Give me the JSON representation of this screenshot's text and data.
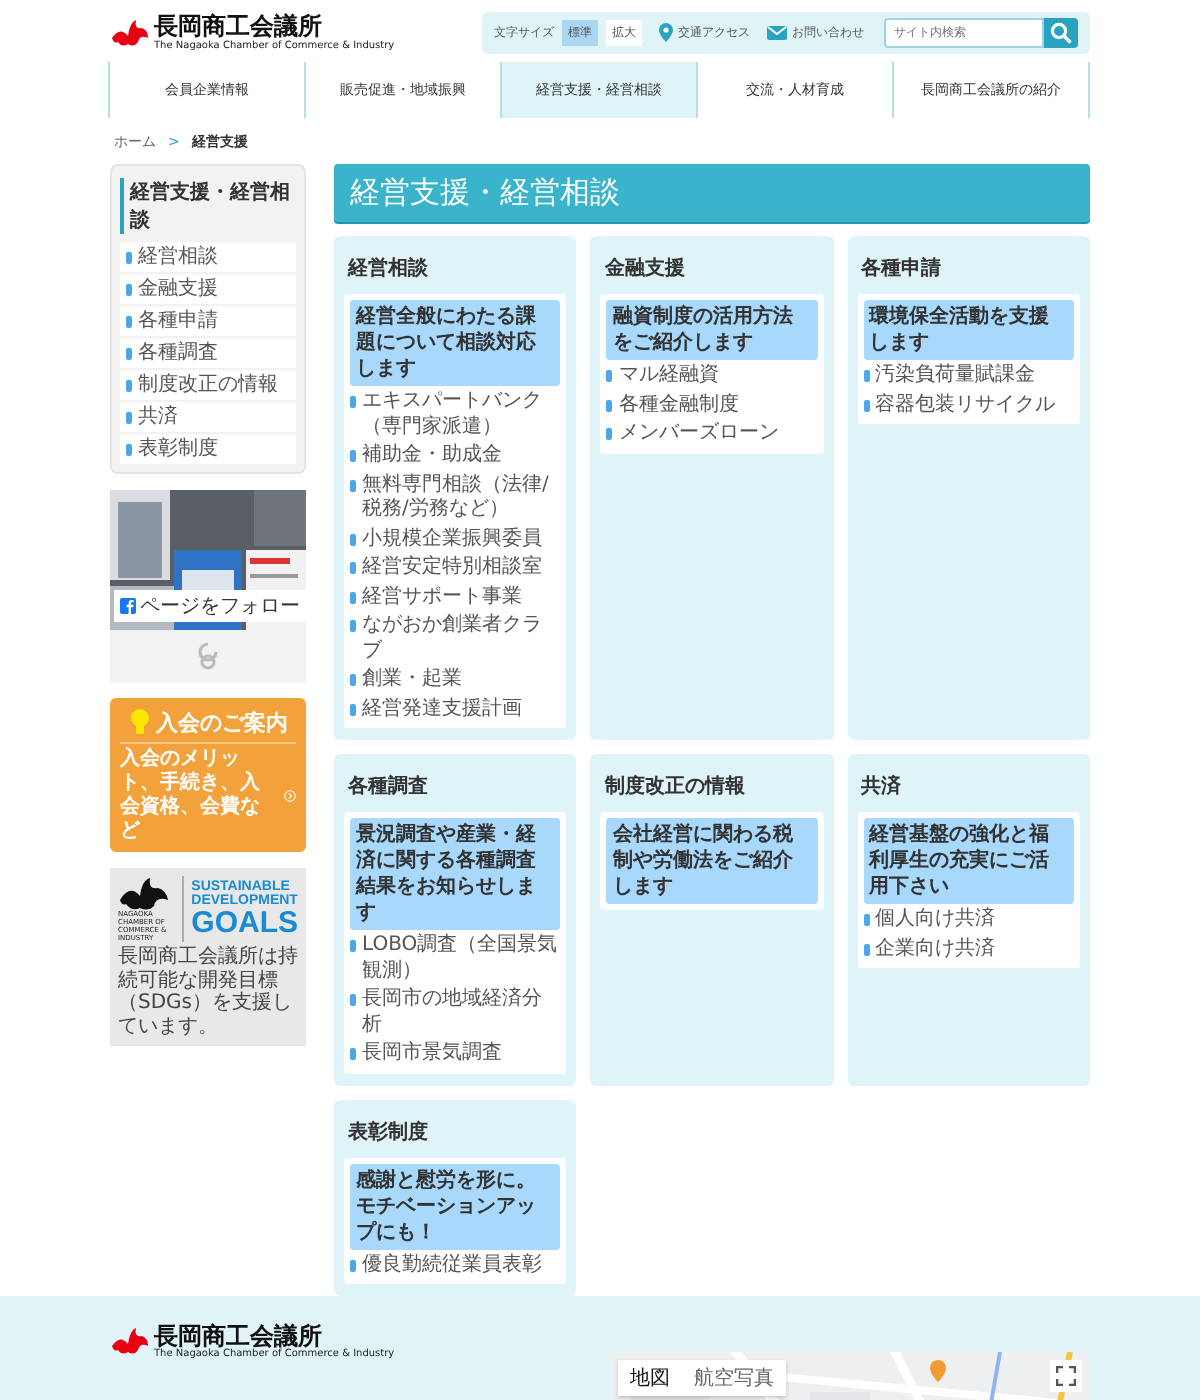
{
  "header": {
    "logo": {
      "name": "長岡商工会議所",
      "subtitle": "The Nagaoka Chamber of Commerce & Industry"
    },
    "font_size": {
      "label": "文字サイズ",
      "options": [
        {
          "label": "標準",
          "selected": true
        },
        {
          "label": "拡大",
          "selected": false
        }
      ]
    },
    "links": [
      {
        "label": "交通アクセス",
        "kind": "pin"
      },
      {
        "label": "お問い合わせ",
        "kind": "mail"
      }
    ],
    "search": {
      "placeholder": "サイト内検索"
    }
  },
  "nav": [
    {
      "label": "会員企業情報",
      "selected": false
    },
    {
      "label": "販売促進・地域振興",
      "selected": false
    },
    {
      "label": "経営支援・経営相談",
      "selected": true
    },
    {
      "label": "交流・人材育成",
      "selected": false
    },
    {
      "label": "長岡商工会議所の紹介",
      "selected": false
    }
  ],
  "breadcrumb": {
    "items": [
      "ホーム",
      "経営支援"
    ],
    "separator": ">"
  },
  "sidebar": {
    "title": "経営支援・経営相談",
    "items": [
      "経営相談",
      "金融支援",
      "各種申請",
      "各種調査",
      "制度改正の情報",
      "共済",
      "表彰制度"
    ],
    "facebook": {
      "button": "ページをフォロー"
    },
    "join_banner": {
      "title": "入会のご案内",
      "text": "入会のメリット、手続き、入会資格、会費など"
    },
    "sdgs_banner": {
      "org": "NAGAOKA CHAMBER OF COMMERCE & INDUSTRY",
      "lines": [
        "SUSTAINABLE",
        "DEVELOPMENT",
        "GOALS"
      ],
      "note": "長岡商工会議所は持続可能な開発目標（SDGs）を支援しています。"
    }
  },
  "page_title": "経営支援・経営相談",
  "sections": [
    {
      "title": "経営相談",
      "intro": "経営全般にわたる課題について相談対応します",
      "items": [
        "エキスパートバンク（専門家派遣）",
        "補助金・助成金",
        "無料専門相談（法律/税務/労務など）",
        "小規模企業振興委員",
        "経営安定特別相談室",
        "経営サポート事業",
        "ながおか創業者クラブ",
        "創業・起業",
        "経営発達支援計画"
      ]
    },
    {
      "title": "金融支援",
      "intro": "融資制度の活用方法をご紹介します",
      "items": [
        "マル経融資",
        "各種金融制度",
        "メンバーズローン"
      ]
    },
    {
      "title": "各種申請",
      "intro": "環境保全活動を支援します",
      "items": [
        "汚染負荷量賦課金",
        "容器包装リサイクル"
      ]
    },
    {
      "title": "各種調査",
      "intro": "景況調査や産業・経済に関する各種調査結果をお知らせします",
      "items": [
        "LOBO調査（全国景気観測）",
        "長岡市の地域経済分析",
        "長岡市景気調査"
      ]
    },
    {
      "title": "制度改正の情報",
      "intro": "会社経営に関わる税制や労働法をご紹介します"
    },
    {
      "title": "共済",
      "intro": "経営基盤の強化と福利厚生の充実にご活用下さい",
      "items": [
        "個人向け共済",
        "企業向け共済"
      ]
    },
    {
      "title": "表彰制度",
      "intro": "感謝と慰労を形に。モチベーションアップにも！",
      "items": [
        "優良勤続従業員表彰"
      ]
    }
  ],
  "footer": {
    "logo": {
      "name": "長岡商工会議所",
      "subtitle": "The Nagaoka Chamber of Commerce & Industry"
    },
    "map": {
      "buttons": [
        {
          "label": "地図",
          "selected": true
        },
        {
          "label": "航空写真",
          "selected": false
        }
      ]
    }
  }
}
